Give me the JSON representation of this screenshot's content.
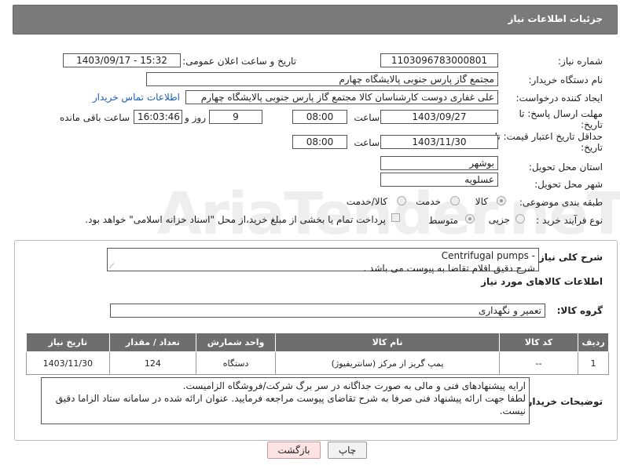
{
  "header": {
    "title": "جزئیات اطلاعات نیاز"
  },
  "form": {
    "need_number": {
      "label": "شماره نیاز:",
      "value": "1103096783000801"
    },
    "announce_datetime": {
      "label": "تاریخ و ساعت اعلان عمومی:",
      "value": "1403/09/17 - 15:32"
    },
    "buyer_org": {
      "label": "نام دستگاه خریدار:",
      "value": "مجتمع گاز پارس جنوبی  پالایشگاه چهارم"
    },
    "requester": {
      "label": "ایجاد کننده درخواست:",
      "value": "علی غفاری دوست کارشناسان کالا مجتمع گاز پارس جنوبی  پالایشگاه چهارم",
      "contact_link": "اطلاعات تماس خریدار"
    },
    "response_deadline": {
      "label_line1": "مهلت ارسال پاسخ: تا",
      "label_line2": "تاریخ:",
      "date": "1403/09/27",
      "time_label": "ساعت",
      "time": "08:00",
      "days": "9",
      "days_label": "روز و",
      "remaining": "16:03:46",
      "remaining_label": "ساعت باقی مانده"
    },
    "price_validity": {
      "label_line1": "حداقل تاریخ اعتبار قیمت: تا",
      "label_line2": "تاریخ:",
      "date": "1403/11/30",
      "time_label": "ساعت",
      "time": "08:00"
    },
    "province": {
      "label": "استان محل تحویل:",
      "value": "بوشهر"
    },
    "city": {
      "label": "شهر محل تحویل:",
      "value": "عسلویه"
    },
    "category": {
      "label": "طبقه بندی موضوعی:",
      "options": [
        "کالا",
        "خدمت",
        "کالا/خدمت"
      ],
      "selected": "کالا"
    },
    "purchase_process": {
      "label": "نوع فرآیند خرید :",
      "options": [
        "جزیی",
        "متوسط"
      ],
      "selected": "متوسط",
      "treasury_note": "پرداخت تمام یا بخشی از مبلغ خرید،از محل \"اسناد خزانه اسلامی\" خواهد بود."
    }
  },
  "details": {
    "description_label": "شرح کلی نیاز:",
    "description_line1": "Centrifugal pumps -",
    "description_line2": "شرح دقیق اقلام تقاضا به پیوست می باشد .",
    "goods_info_title": "اطلاعات کالاهای مورد نیاز",
    "goods_group_label": "گروه کالا:",
    "goods_group_value": "تعمیر و نگهداری",
    "table": {
      "headers": [
        "ردیف",
        "کد کالا",
        "نام کالا",
        "واحد شمارش",
        "تعداد / مقدار",
        "تاریخ نیاز"
      ],
      "rows": [
        [
          "1",
          "--",
          "پمپ گریز از مرکز (سانتریفیوژ)",
          "دستگاه",
          "124",
          "1403/11/30"
        ]
      ]
    },
    "buyer_notes_label": "توضیحات خریدار:",
    "buyer_notes_line1": "ارایه پیشنهادهای فنی و مالی به صورت جداگانه در سر برگ شرکت/فروشگاه الزامیست.",
    "buyer_notes_line2": "لطفا جهت ارائه پیشنهاد فنی صرفا به شرح تقاضای پیوست مراجعه فرمایید. عنوان ارائه شده در سامانه ستاد الزاما دقیق نیست."
  },
  "buttons": {
    "print": "چاپ",
    "back": "بازگشت"
  },
  "watermark": "AriaTender.neT",
  "colors": {
    "header_bg": "#7a7a7a",
    "table_header_bg": "#6e6e6e",
    "link": "#1a5fb4",
    "back_button_bg": "#fde3e3"
  }
}
